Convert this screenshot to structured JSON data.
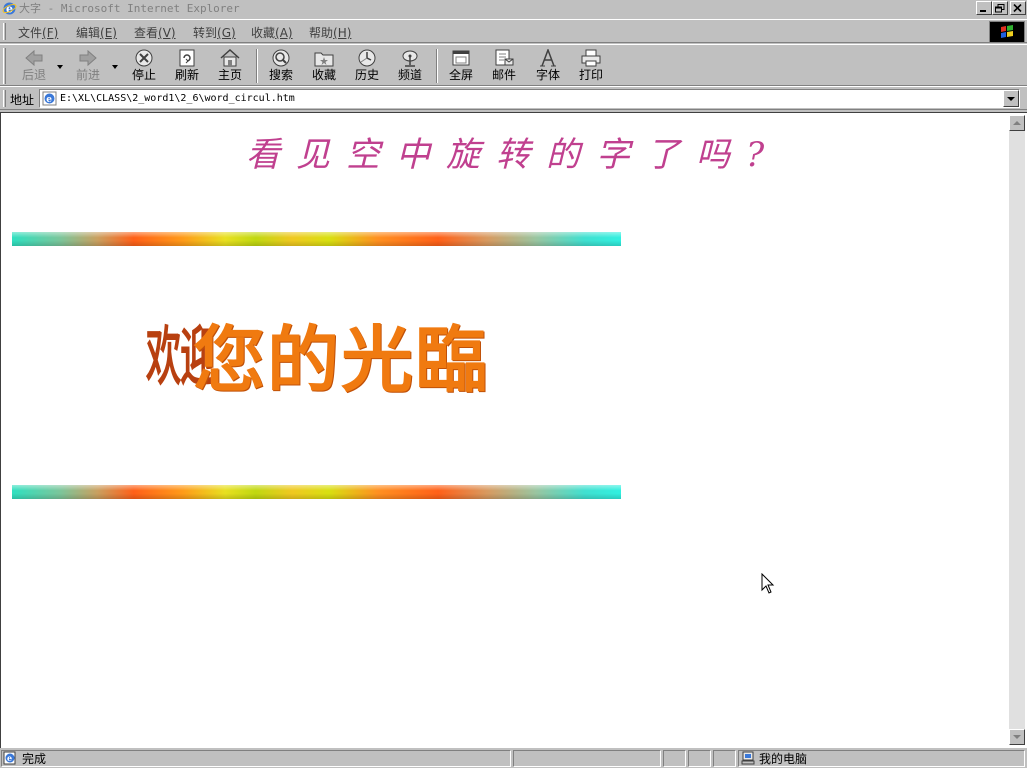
{
  "window": {
    "title": "大字 - Microsoft Internet Explorer"
  },
  "menu": {
    "items": [
      {
        "label": "文件",
        "key": "(F)"
      },
      {
        "label": "编辑",
        "key": "(E)"
      },
      {
        "label": "查看",
        "key": "(V)"
      },
      {
        "label": "转到",
        "key": "(G)"
      },
      {
        "label": "收藏",
        "key": "(A)"
      },
      {
        "label": "帮助",
        "key": "(H)"
      }
    ]
  },
  "toolbar": {
    "back": "后退",
    "forward": "前进",
    "stop": "停止",
    "refresh": "刷新",
    "home": "主页",
    "search": "搜索",
    "favorites": "收藏",
    "history": "历史",
    "channels": "频道",
    "fullscreen": "全屏",
    "mail": "邮件",
    "fonts": "字体",
    "print": "打印"
  },
  "address": {
    "label": "地址",
    "url": "E:\\XL\\CLASS\\2_word1\\2_6\\word_circul.htm"
  },
  "page": {
    "heading": "看见空中旋转的字了吗?",
    "rotating_ghost": "欢迎",
    "rotating_main": "您的光臨"
  },
  "status": {
    "text": "完成",
    "zone": "我的电脑"
  },
  "colors": {
    "heading": "#c0408f",
    "rotating_text": "#f07a10"
  }
}
